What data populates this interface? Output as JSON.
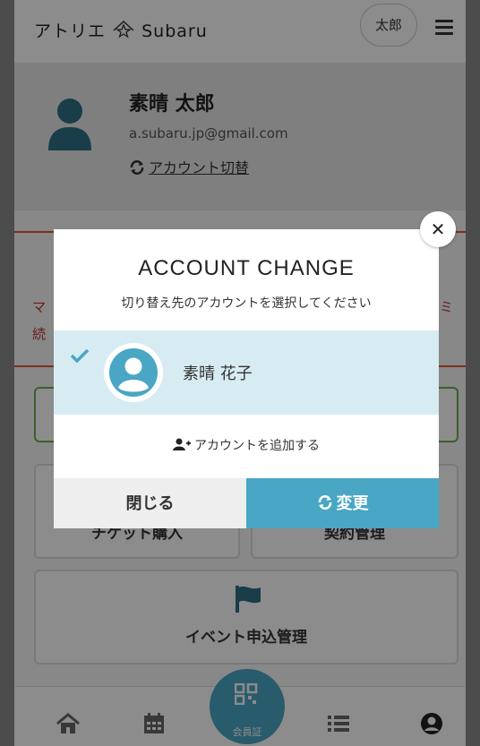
{
  "header": {
    "logo_text": "Subaru",
    "logo_prefix": "アトリエ",
    "user_chip": "太郎"
  },
  "profile": {
    "name": "素晴 太郎",
    "email": "a.subaru.jp@gmail.com",
    "switch_label": "アカウント切替"
  },
  "notice": {
    "line1_start": "マ",
    "line2_start": "続",
    "line1_end": "ミ"
  },
  "tiles": {
    "ticket": "チケット購入",
    "contract": "契約管理",
    "event": "イベント申込管理"
  },
  "bottom_nav": {
    "home_icon": "home-icon",
    "calendar_icon": "calendar-icon",
    "center_caption": "会員証",
    "list_icon": "list-icon",
    "profile_icon": "user-circle-icon"
  },
  "modal": {
    "title": "ACCOUNT CHANGE",
    "subtitle": "切り替え先のアカウントを選択してください",
    "accounts": [
      {
        "name": "素晴 花子",
        "selected": true
      }
    ],
    "add_account_label": "アカウントを追加する",
    "close_button": "閉じる",
    "change_button": "変更"
  },
  "colors": {
    "accent": "#49a6c4",
    "selected_row": "#d7ecf2",
    "notice_border": "#e05a3a",
    "green_border": "#6ab04c"
  }
}
